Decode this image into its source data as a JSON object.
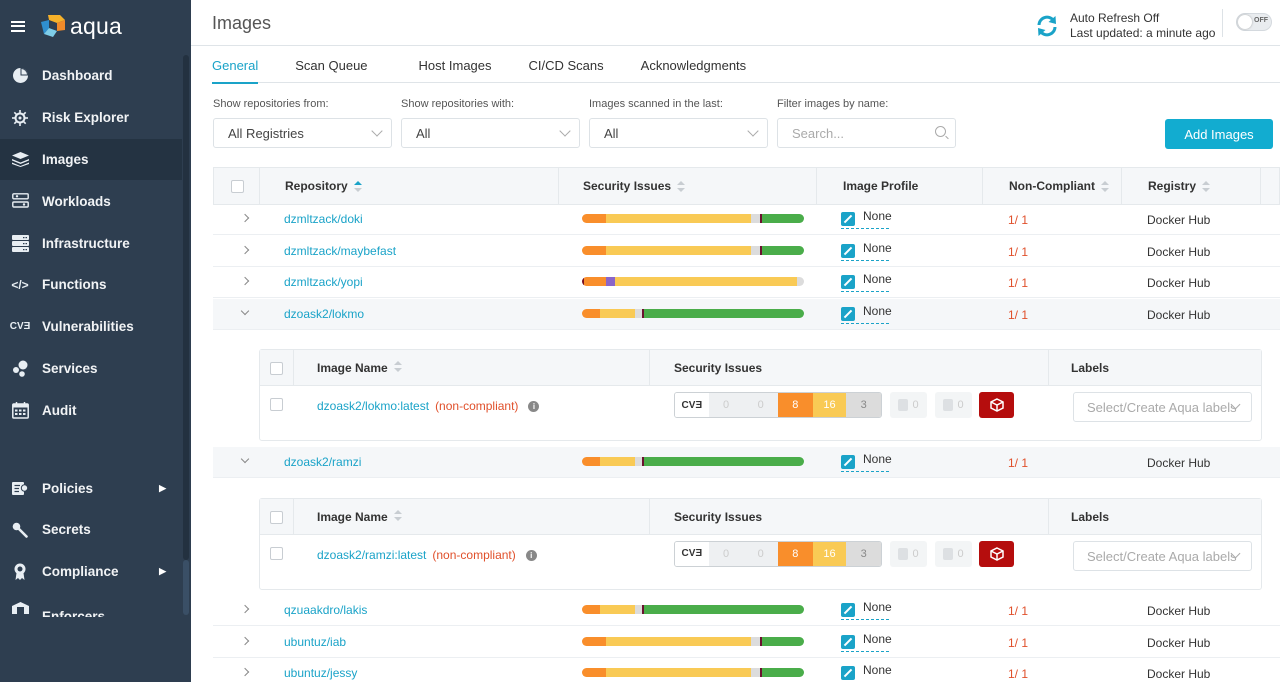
{
  "app": {
    "name": "aqua"
  },
  "sidebar": {
    "items": [
      {
        "label": "Dashboard",
        "icon": "pie-chart-icon",
        "active": false
      },
      {
        "label": "Risk Explorer",
        "icon": "ship-wheel-icon",
        "active": false
      },
      {
        "label": "Images",
        "icon": "layers-icon",
        "active": true
      },
      {
        "label": "Workloads",
        "icon": "workloads-icon",
        "active": false
      },
      {
        "label": "Infrastructure",
        "icon": "server-icon",
        "active": false
      },
      {
        "label": "Functions",
        "icon": "code-icon",
        "active": false
      },
      {
        "label": "Vulnerabilities",
        "icon": "cve-icon",
        "active": false
      },
      {
        "label": "Services",
        "icon": "hexagons-icon",
        "active": false
      },
      {
        "label": "Audit",
        "icon": "calendar-icon",
        "active": false
      }
    ],
    "items2": [
      {
        "label": "Policies",
        "icon": "policy-icon",
        "submenu": true
      },
      {
        "label": "Secrets",
        "icon": "key-icon",
        "submenu": false
      },
      {
        "label": "Compliance",
        "icon": "ribbon-icon",
        "submenu": true
      },
      {
        "label": "Enforcers",
        "icon": "enforcer-icon",
        "submenu": false
      }
    ],
    "icon_glyphs": {
      "cve": "CVƎ",
      "code": "</>"
    }
  },
  "header": {
    "title": "Images",
    "auto_refresh": "Auto Refresh Off",
    "last_updated": "Last updated: a minute ago",
    "toggle_label": "OFF"
  },
  "tabs": [
    {
      "label": "General",
      "active": true
    },
    {
      "label": "Scan Queue",
      "active": false
    },
    {
      "label": "Host Images",
      "active": false
    },
    {
      "label": "CI/CD Scans",
      "active": false
    },
    {
      "label": "Acknowledgments",
      "active": false
    }
  ],
  "filters": {
    "registries": {
      "label": "Show repositories from:",
      "value": "All Registries"
    },
    "with": {
      "label": "Show repositories with:",
      "value": "All"
    },
    "scanned": {
      "label": "Images scanned in the last:",
      "value": "All"
    },
    "name": {
      "label": "Filter images by name:",
      "placeholder": "Search..."
    }
  },
  "add_button": "Add Images",
  "table": {
    "columns": [
      "Repository",
      "Security Issues",
      "Image Profile",
      "Non-Compliant",
      "Registry"
    ],
    "rows": [
      {
        "repo": "dzmltzack/doki",
        "profile": "None",
        "noncompliant": "1/ 1",
        "registry": "Docker Hub",
        "expanded": false,
        "bar": [
          [
            "#f98e2b",
            11
          ],
          [
            "#f9ca55",
            65
          ],
          [
            "#dcdcdc",
            4
          ],
          [
            "#6b1230",
            1
          ],
          [
            "#4aad4a",
            19
          ]
        ]
      },
      {
        "repo": "dzmltzack/maybefast",
        "profile": "None",
        "noncompliant": "1/ 1",
        "registry": "Docker Hub",
        "expanded": false,
        "bar": [
          [
            "#f98e2b",
            11
          ],
          [
            "#f9ca55",
            65
          ],
          [
            "#dcdcdc",
            4
          ],
          [
            "#6b1230",
            1
          ],
          [
            "#4aad4a",
            19
          ]
        ]
      },
      {
        "repo": "dzmltzack/yopi",
        "profile": "None",
        "noncompliant": "1/ 1",
        "registry": "Docker Hub",
        "expanded": false,
        "bar": [
          [
            "#7a1020",
            1
          ],
          [
            "#f98e2b",
            10
          ],
          [
            "#8a65c8",
            4
          ],
          [
            "#f9ca55",
            82
          ],
          [
            "#dcdcdc",
            3
          ]
        ]
      },
      {
        "repo": "dzoask2/lokmo",
        "profile": "None",
        "noncompliant": "1/ 1",
        "registry": "Docker Hub",
        "expanded": true,
        "bar": [
          [
            "#f98e2b",
            8
          ],
          [
            "#f9ca55",
            16
          ],
          [
            "#dcdcdc",
            3
          ],
          [
            "#6b1230",
            1
          ],
          [
            "#4aad4a",
            72
          ]
        ]
      },
      {
        "repo": "dzoask2/ramzi",
        "profile": "None",
        "noncompliant": "1/ 1",
        "registry": "Docker Hub",
        "expanded": true,
        "bar": [
          [
            "#f98e2b",
            8
          ],
          [
            "#f9ca55",
            16
          ],
          [
            "#dcdcdc",
            3
          ],
          [
            "#6b1230",
            1
          ],
          [
            "#4aad4a",
            72
          ]
        ]
      },
      {
        "repo": "qzuaakdro/lakis",
        "profile": "None",
        "noncompliant": "1/ 1",
        "registry": "Docker Hub",
        "expanded": false,
        "bar": [
          [
            "#f98e2b",
            8
          ],
          [
            "#f9ca55",
            16
          ],
          [
            "#dcdcdc",
            3
          ],
          [
            "#6b1230",
            1
          ],
          [
            "#4aad4a",
            72
          ]
        ]
      },
      {
        "repo": "ubuntuz/iab",
        "profile": "None",
        "noncompliant": "1/ 1",
        "registry": "Docker Hub",
        "expanded": false,
        "bar": [
          [
            "#f98e2b",
            11
          ],
          [
            "#f9ca55",
            65
          ],
          [
            "#dcdcdc",
            4
          ],
          [
            "#6b1230",
            1
          ],
          [
            "#4aad4a",
            19
          ]
        ]
      },
      {
        "repo": "ubuntuz/jessy",
        "profile": "None",
        "noncompliant": "1/ 1",
        "registry": "Docker Hub",
        "expanded": false,
        "bar": [
          [
            "#f98e2b",
            11
          ],
          [
            "#f9ca55",
            65
          ],
          [
            "#dcdcdc",
            4
          ],
          [
            "#6b1230",
            1
          ],
          [
            "#4aad4a",
            19
          ]
        ]
      }
    ],
    "subtables": [
      {
        "columns": [
          "Image Name",
          "Security Issues",
          "Labels"
        ],
        "image": "dzoask2/lokmo:latest",
        "status": "(non-compliant)",
        "cve_label": "CVƎ",
        "critical": "0",
        "critical2": "0",
        "high": "8",
        "medium": "16",
        "low": "3",
        "sensitive": "0",
        "malware": "0",
        "labels_placeholder": "Select/Create Aqua labels"
      },
      {
        "columns": [
          "Image Name",
          "Security Issues",
          "Labels"
        ],
        "image": "dzoask2/ramzi:latest",
        "status": "(non-compliant)",
        "cve_label": "CVƎ",
        "critical": "0",
        "critical2": "0",
        "high": "8",
        "medium": "16",
        "low": "3",
        "sensitive": "0",
        "malware": "0",
        "labels_placeholder": "Select/Create Aqua labels"
      }
    ]
  },
  "colors": {
    "accent": "#1aa3c8",
    "sidebar": "#2e3e50",
    "danger": "#e0502b",
    "high": "#f98e2b",
    "medium": "#f9ca55",
    "low": "#dcdcdc",
    "ok": "#4aad4a",
    "malware": "#b50d0d"
  }
}
